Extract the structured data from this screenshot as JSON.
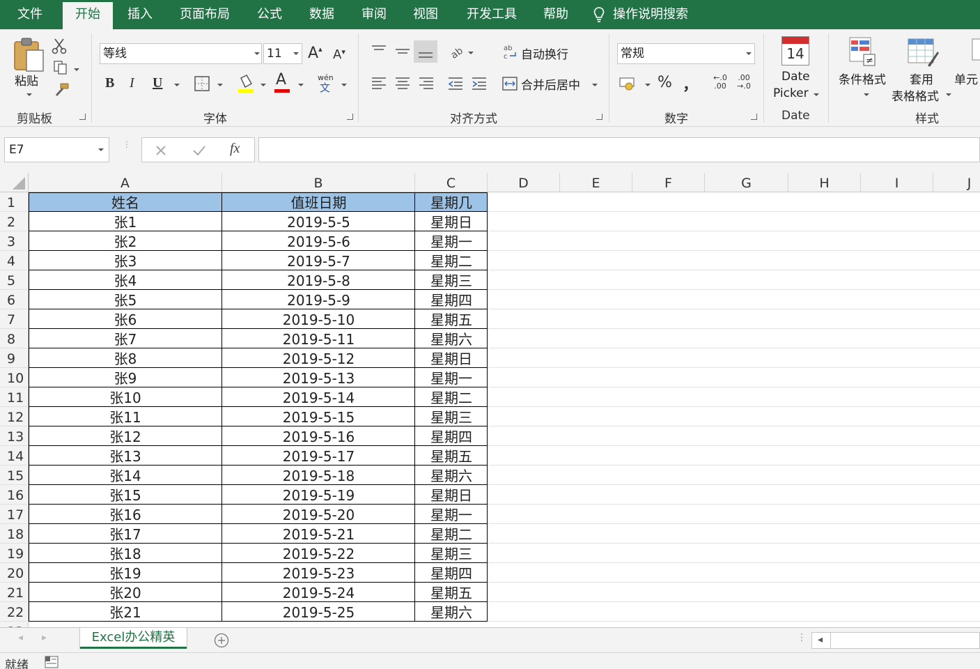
{
  "tabs": [
    "文件",
    "开始",
    "插入",
    "页面布局",
    "公式",
    "数据",
    "审阅",
    "视图",
    "开发工具",
    "帮助"
  ],
  "tell_me": "操作说明搜索",
  "ribbon": {
    "clipboard": {
      "paste_label": "粘贴",
      "group_label": "剪贴板"
    },
    "font": {
      "font_name": "等线",
      "font_size": "11",
      "bold": "B",
      "italic": "I",
      "underline": "U",
      "phonetic_top": "wén",
      "phonetic_bottom": "文",
      "group_label": "字体",
      "font_color": "#e00000",
      "fill_color": "#ffff00"
    },
    "alignment": {
      "wrap_text": "自动换行",
      "merge_center": "合并后居中",
      "group_label": "对齐方式"
    },
    "number": {
      "format": "常规",
      "percent": "%",
      "comma": "，",
      "inc_top": "←.0",
      "inc_bottom": ".00",
      "dec_top": ".00",
      "dec_bottom": "→.0",
      "group_label": "数字"
    },
    "date": {
      "calendar_day": "14",
      "line1": "Date",
      "line2": "Picker",
      "group_label": "Date"
    },
    "styles": {
      "conditional": "条件格式",
      "table_line1": "套用",
      "table_line2": "表格格式",
      "cell_styles": "单元",
      "group_label": "样式"
    }
  },
  "formula_bar": {
    "name_box": "E7",
    "fx": "fx",
    "formula": ""
  },
  "columns": [
    "A",
    "B",
    "C",
    "D",
    "E",
    "F",
    "G",
    "H",
    "I",
    "J"
  ],
  "rows": [
    [
      "姓名",
      "值班日期",
      "星期几"
    ],
    [
      "张1",
      "2019-5-5",
      "星期日"
    ],
    [
      "张2",
      "2019-5-6",
      "星期一"
    ],
    [
      "张3",
      "2019-5-7",
      "星期二"
    ],
    [
      "张4",
      "2019-5-8",
      "星期三"
    ],
    [
      "张5",
      "2019-5-9",
      "星期四"
    ],
    [
      "张6",
      "2019-5-10",
      "星期五"
    ],
    [
      "张7",
      "2019-5-11",
      "星期六"
    ],
    [
      "张8",
      "2019-5-12",
      "星期日"
    ],
    [
      "张9",
      "2019-5-13",
      "星期一"
    ],
    [
      "张10",
      "2019-5-14",
      "星期二"
    ],
    [
      "张11",
      "2019-5-15",
      "星期三"
    ],
    [
      "张12",
      "2019-5-16",
      "星期四"
    ],
    [
      "张13",
      "2019-5-17",
      "星期五"
    ],
    [
      "张14",
      "2019-5-18",
      "星期六"
    ],
    [
      "张15",
      "2019-5-19",
      "星期日"
    ],
    [
      "张16",
      "2019-5-20",
      "星期一"
    ],
    [
      "张17",
      "2019-5-21",
      "星期二"
    ],
    [
      "张18",
      "2019-5-22",
      "星期三"
    ],
    [
      "张19",
      "2019-5-23",
      "星期四"
    ],
    [
      "张20",
      "2019-5-24",
      "星期五"
    ],
    [
      "张21",
      "2019-5-25",
      "星期六"
    ]
  ],
  "header_fill": "#9dc3e6",
  "sheet_tab": "Excel办公精英",
  "status": "就绪",
  "accent": "#217346"
}
